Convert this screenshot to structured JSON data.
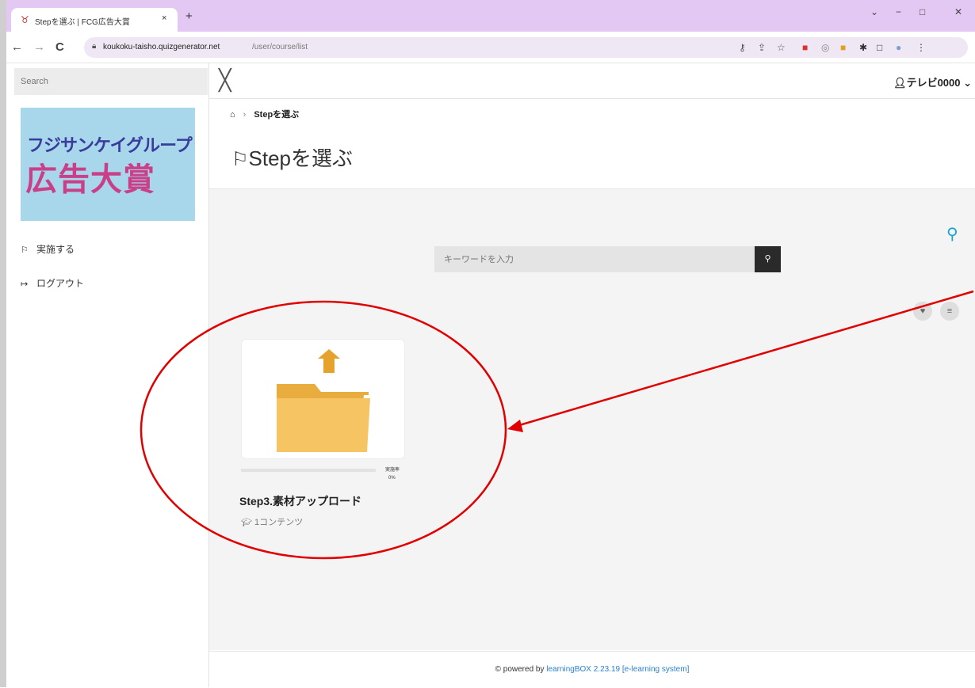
{
  "browser": {
    "tab_title": "Stepを選ぶ | FCG広告大賞",
    "tab_close": "×",
    "new_tab": "+",
    "url_host": "koukoku-taisho.quizgenerator.net",
    "url_path": "/user/course/list",
    "win_controls": [
      "⌄",
      "−",
      "□",
      "✕"
    ]
  },
  "sidebar": {
    "search_placeholder": "Search",
    "logo_line1": "フジサンケイグループ",
    "logo_line2": "広告大賞",
    "items": [
      {
        "label": "実施する",
        "icon": "flag-icon"
      },
      {
        "label": "ログアウト",
        "icon": "logout-icon"
      }
    ]
  },
  "header": {
    "user_name": "テレビ0000",
    "close_glyph": "╳"
  },
  "breadcrumb": {
    "current": "Stepを選ぶ"
  },
  "page": {
    "title": "Stepを選ぶ"
  },
  "search": {
    "placeholder": "キーワードを入力"
  },
  "card": {
    "title": "Step3.素材アップロード",
    "rate_label": "実施率",
    "rate_value": "0%",
    "rate": 0,
    "meta": "1コンテンツ"
  },
  "footer": {
    "prefix": "© powered by ",
    "link": "learningBOX 2.23.19 [e-learning system]"
  },
  "colors": {
    "accent": "#1aa3c9",
    "annotation": "#e00000",
    "folder": "#f2bf5a",
    "arrow": "#e5a22d",
    "tabbar": "#e3c8f4"
  }
}
